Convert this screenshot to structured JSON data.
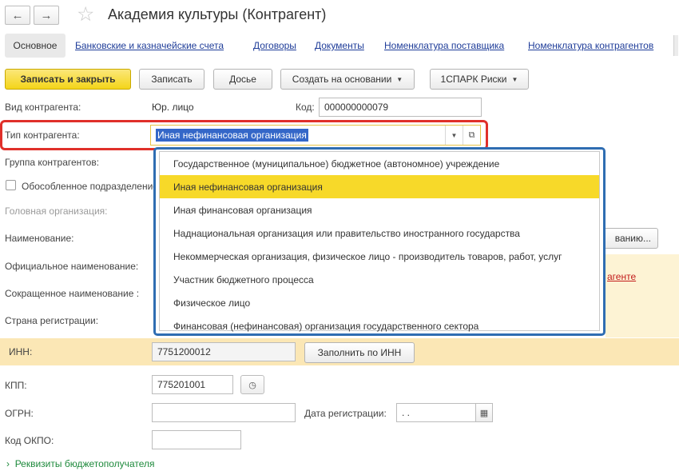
{
  "window": {
    "title": "Академия культуры (Контрагент)",
    "back_icon": "←",
    "forward_icon": "→",
    "favorite_icon": "☆"
  },
  "tabs": [
    {
      "label": "Основное",
      "active": true
    },
    {
      "label": "Банковские и казначейские счета"
    },
    {
      "label": "Договоры"
    },
    {
      "label": "Документы"
    },
    {
      "label": "Номенклатура поставщика"
    },
    {
      "label": "Номенклатура контрагентов"
    }
  ],
  "toolbar": {
    "save_close": "Записать и закрыть",
    "save": "Записать",
    "dossier": "Досье",
    "create_based": "Создать на основании",
    "spark": "1СПАРК Риски"
  },
  "form": {
    "kind_label": "Вид контрагента:",
    "kind_value": "Юр. лицо",
    "code_label": "Код:",
    "code_value": "000000000079",
    "type_label": "Тип контрагента:",
    "type_value": "Иная нефинансовая организация",
    "group_label": "Группа контрагентов:",
    "separate_label": "Обособленное подразделение",
    "head_org_label": "Головная организация:",
    "name_label": "Наименование:",
    "name_button_tail": "ванию...",
    "official_name_label": "Официальное наименование:",
    "short_name_label": "Сокращенное наименование :",
    "country_label": "Страна регистрации:",
    "warning_link": "агенте",
    "inn_label": "ИНН:",
    "inn_value": "7751200012",
    "fill_by_inn": "Заполнить по ИНН",
    "kpp_label": "КПП:",
    "kpp_value": "775201001",
    "ogrn_label": "ОГРН:",
    "ogrn_value": "",
    "reg_date_label": "Дата регистрации:",
    "reg_date_value": " .  .",
    "okpo_label": "Код ОКПО:",
    "okpo_value": "",
    "budget_details": "Реквизиты бюджетополучателя"
  },
  "dropdown": {
    "items": [
      "Государственное (муниципальное) бюджетное (автономное) учреждение",
      "Иная нефинансовая организация",
      "Иная финансовая организация",
      "Наднациональная организация или правительство иностранного государства",
      "Некоммерческая организация, физическое лицо - производитель товаров, работ, услуг",
      "Участник бюджетного процесса",
      "Физическое лицо",
      "Финансовая (нефинансовая) организация государственного сектора"
    ],
    "selected_index": 1
  },
  "colors": {
    "primary_button": "#f4d51a",
    "link": "#1f3d99",
    "highlight_red": "#e0302a",
    "dropdown_border": "#2f6db2",
    "selected_item": "#f7d929",
    "inn_band": "#fbe7b5"
  }
}
